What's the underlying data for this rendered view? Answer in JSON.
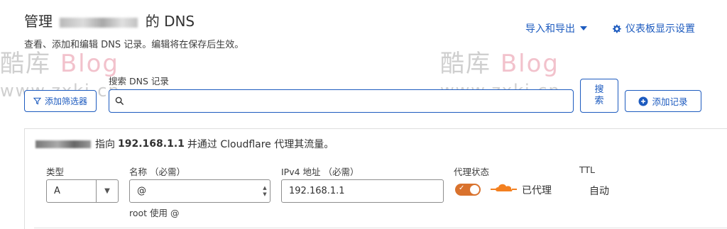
{
  "header": {
    "title_prefix": "管理",
    "title_suffix": "的 DNS",
    "subtitle": "查看、添加和编辑 DNS 记录。编辑将在保存后生效。",
    "import_export": "导入和导出",
    "dashboard_settings": "仪表板显示设置"
  },
  "watermark": {
    "text_cn": "酷库",
    "text_blog": "Blog",
    "url": "www.zxki.cn"
  },
  "search": {
    "label": "搜索 DNS 记录",
    "value": "",
    "filter_button": "添加筛选器",
    "search_button_line1": "搜",
    "search_button_line2": "索",
    "add_record_button": "添加记录"
  },
  "record": {
    "points_to_prefix": "指向",
    "ip_bold": "192.168.1.1",
    "points_to_suffix": "并通过 Cloudflare 代理其流量。",
    "type_label": "类型",
    "type_value": "A",
    "name_label": "名称 （必需）",
    "name_value": "@",
    "ipv4_label": "IPv4 地址 （必需）",
    "ipv4_value": "192.168.1.1",
    "proxy_label": "代理状态",
    "proxy_status": "已代理",
    "ttl_label": "TTL",
    "ttl_value": "自动",
    "name_hint": "root 使用 @"
  },
  "colors": {
    "accent": "#1d5bbf",
    "proxy_orange": "#d9722d",
    "cloud_orange": "#f38020"
  }
}
